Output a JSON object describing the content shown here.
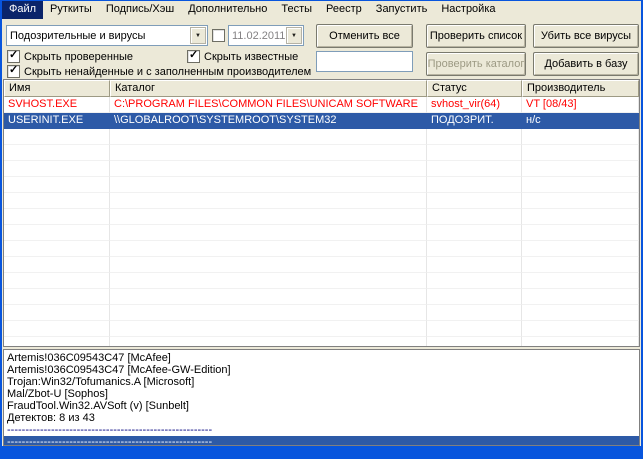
{
  "icons": {
    "dropdown_arrow": "▼",
    "checkmark": "✓"
  },
  "colors": {
    "virus_text": "#FF0000",
    "selection_bg": "#2D5AA7",
    "menu_highlight": "#0A246A",
    "frame_blue": "#0855DD"
  },
  "menu": {
    "items": [
      {
        "label": "Файл",
        "active": true
      },
      {
        "label": "Руткиты",
        "active": false
      },
      {
        "label": "Подпись/Хэш",
        "active": false
      },
      {
        "label": "Дополнительно",
        "active": false
      },
      {
        "label": "Тесты",
        "active": false
      },
      {
        "label": "Реестр",
        "active": false
      },
      {
        "label": "Запустить",
        "active": false
      },
      {
        "label": "Настройка",
        "active": false
      }
    ]
  },
  "toolbar": {
    "filter_value": "Подозрительные и вирусы",
    "date_value": "11.02.2011",
    "date_checkbox_checked": false,
    "cancel_all": "Отменить все",
    "check_list": "Проверить список",
    "kill_all": "Убить все вирусы",
    "hide_checked": "Скрыть проверенные",
    "hide_known": "Скрыть известные",
    "hide_notfound": "Скрыть ненайденные и с заполненным производителем",
    "path_value": "",
    "check_folder": "Проверить каталог",
    "add_to_base": "Добавить в базу"
  },
  "table": {
    "columns": [
      "Имя",
      "Каталог",
      "Статус",
      "Производитель"
    ],
    "rows": [
      {
        "name": "SVHOST.EXE",
        "path": "C:\\PROGRAM FILES\\COMMON FILES\\UNICAM SOFTWARE",
        "status": "svhost_vir(64)",
        "vendor": "VT [08/43]",
        "state": "virus"
      },
      {
        "name": "USERINIT.EXE",
        "path": "\\\\GLOBALROOT\\SYSTEMROOT\\SYSTEM32",
        "status": "ПОДОЗРИТ.",
        "vendor": "н/с",
        "state": "selected"
      }
    ],
    "empty_row_count": 14
  },
  "details": {
    "lines": [
      {
        "text": "Artemis!036C09543C47 [McAfee]",
        "sep": false,
        "selected": false
      },
      {
        "text": "Artemis!036C09543C47 [McAfee-GW-Edition]",
        "sep": false,
        "selected": false
      },
      {
        "text": "Trojan:Win32/Tofumanics.A [Microsoft]",
        "sep": false,
        "selected": false
      },
      {
        "text": "Mal/Zbot-U [Sophos]",
        "sep": false,
        "selected": false
      },
      {
        "text": "FraudTool.Win32.AVSoft (v) [Sunbelt]",
        "sep": false,
        "selected": false
      },
      {
        "text": "Детектов: 8 из 43",
        "sep": false,
        "selected": false
      },
      {
        "text": "--------------------------------------------------------",
        "sep": true,
        "selected": false
      },
      {
        "text": "--------------------------------------------------------",
        "sep": true,
        "selected": true
      }
    ]
  }
}
